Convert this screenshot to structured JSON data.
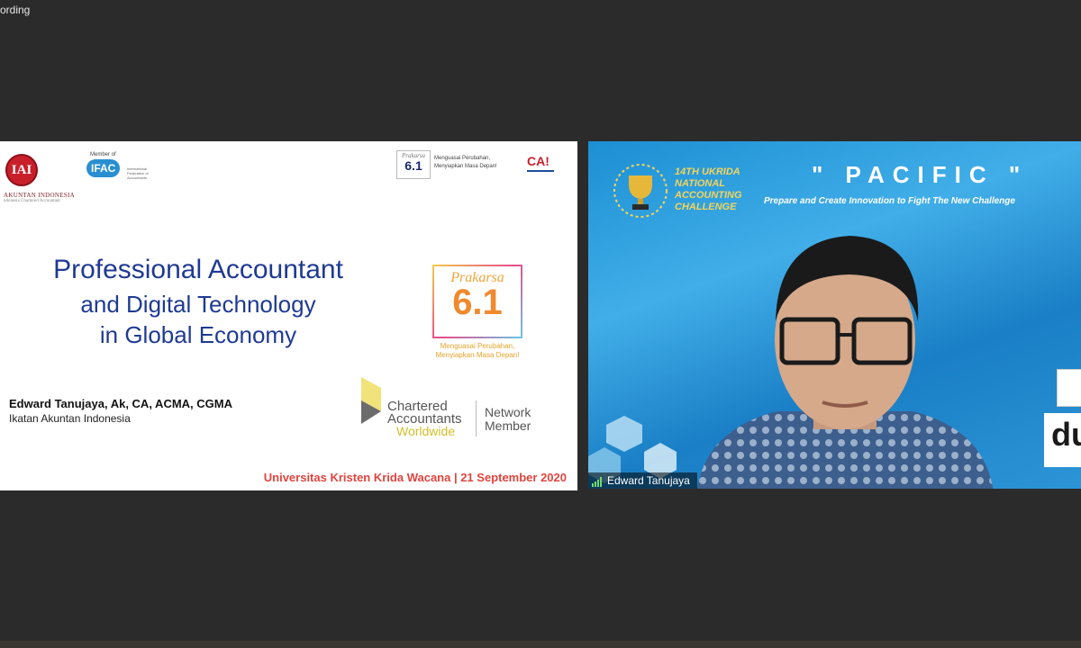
{
  "window": {
    "recording_label": "ording"
  },
  "slide": {
    "iai": {
      "badge": "IAI",
      "name": "AKUNTAN INDONESIA",
      "sub": "ndonesia Chartered Accountant"
    },
    "ifac": {
      "member_label": "Member of",
      "mark": "IFAC",
      "desc": "International Federation of Accountants"
    },
    "prakarsa_small": {
      "word": "Prakarsa",
      "number": "6.1",
      "tagline_1": "Menguasai Perubahan,",
      "tagline_2": "Menyiapkan Masa Depan!"
    },
    "ca_mark": "CA!",
    "title_line_1": "Professional Accountant",
    "title_line_2": "and Digital Technology",
    "title_line_3": "in Global Economy",
    "prakarsa_big": {
      "word": "Prakarsa",
      "number": "6.1",
      "tagline_1": "Menguasai Perubahan,",
      "tagline_2": "Menyiapkan Masa Depan!"
    },
    "speaker_name": "Edward Tanujaya, Ak, CA, ACMA, CGMA",
    "speaker_org": "Ikatan Akuntan Indonesia",
    "caw": {
      "line_1": "Chartered",
      "line_2": "Accountants",
      "line_3": "Worldwide",
      "network_1": "Network",
      "network_2": "Member"
    },
    "footer": "Universitas Kristen Krida Wacana | 21 September 2020"
  },
  "video": {
    "event_1": "14TH UKRIDA",
    "event_2": "NATIONAL",
    "event_3": "ACCOUNTING",
    "event_4": "CHALLENGE",
    "pacific": "\" PACIFIC \"",
    "pacific_sub": "Prepare and Create Innovation to Fight The New Challenge",
    "banner_text": "dun",
    "participant_name": "Edward Tanujaya"
  },
  "colors": {
    "slide_title": "#1f3a93",
    "footer_red": "#e0443e",
    "video_blue": "#1c8fd3",
    "iai_red": "#c8202b"
  }
}
